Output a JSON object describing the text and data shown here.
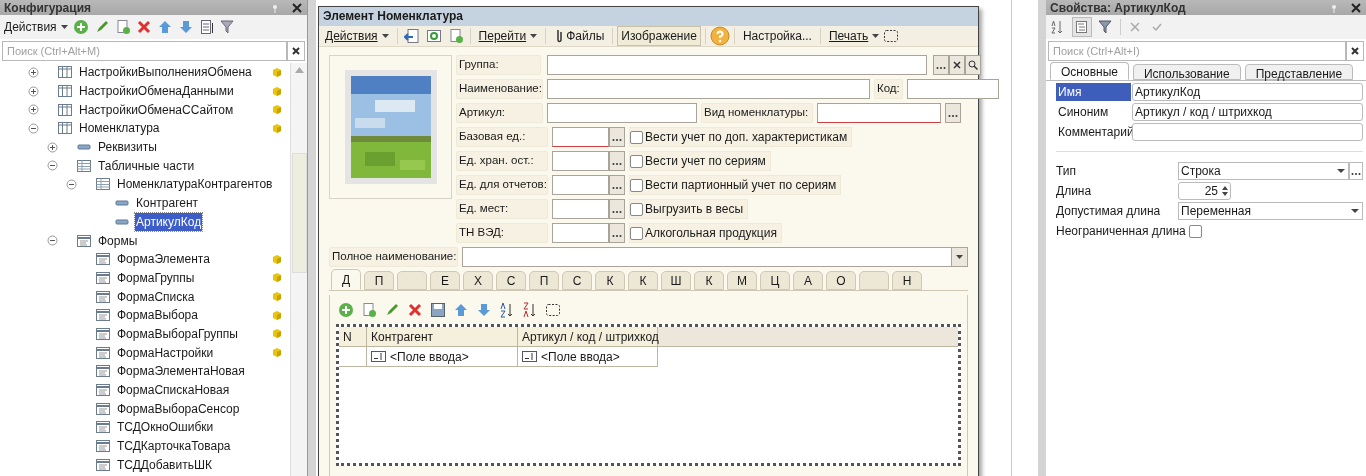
{
  "config_panel": {
    "title": "Конфигурация",
    "actions_menu": "Действия",
    "search": {
      "placeholder": "Поиск (Ctrl+Alt+M)"
    },
    "tree": [
      {
        "label": "НастройкиВыполненияОбмена",
        "kind": "register",
        "expanded": false,
        "locked": true
      },
      {
        "label": "НастройкиОбменаДанными",
        "kind": "register",
        "expanded": false,
        "locked": true
      },
      {
        "label": "НастройкиОбменаССайтом",
        "kind": "register",
        "expanded": false,
        "locked": true
      },
      {
        "label": "Номенклатура",
        "kind": "register",
        "expanded": true,
        "locked": true,
        "children": [
          {
            "label": "Реквизиты",
            "kind": "attribute",
            "expanded": false,
            "locked": false
          },
          {
            "label": "Табличные части",
            "kind": "tabular",
            "expanded": true,
            "locked": false,
            "children": [
              {
                "label": "НоменклатураКонтрагентов",
                "kind": "tabular",
                "expanded": true,
                "locked": false,
                "children": [
                  {
                    "label": "Контрагент",
                    "kind": "attribute",
                    "locked": false,
                    "selected": false
                  },
                  {
                    "label": "АртикулКод",
                    "kind": "attribute",
                    "locked": false,
                    "selected": true
                  }
                ]
              }
            ]
          },
          {
            "label": "Формы",
            "kind": "form",
            "expanded": true,
            "locked": false,
            "children": [
              {
                "label": "ФормаЭлемента",
                "kind": "form",
                "locked": true,
                "selected": false
              },
              {
                "label": "ФормаГруппы",
                "kind": "form",
                "locked": true,
                "selected": false
              },
              {
                "label": "ФормаСписка",
                "kind": "form",
                "locked": true,
                "selected": false
              },
              {
                "label": "ФормаВыбора",
                "kind": "form",
                "locked": true,
                "selected": false
              },
              {
                "label": "ФормаВыбораГруппы",
                "kind": "form",
                "locked": true,
                "selected": false
              },
              {
                "label": "ФормаНастройки",
                "kind": "form",
                "locked": true,
                "selected": false
              },
              {
                "label": "ФормаЭлементаНовая",
                "kind": "form",
                "locked": false,
                "selected": false
              },
              {
                "label": "ФормаСпискаНовая",
                "kind": "form",
                "locked": false,
                "selected": false
              },
              {
                "label": "ФормаВыбораСенсор",
                "kind": "form",
                "locked": false,
                "selected": false
              },
              {
                "label": "ТСДОкноОшибки",
                "kind": "form",
                "locked": false,
                "selected": false
              },
              {
                "label": "ТСДКарточкаТовара",
                "kind": "form",
                "locked": false,
                "selected": false
              },
              {
                "label": "ТСДДобавитьШК",
                "kind": "form",
                "locked": false,
                "selected": false
              }
            ]
          }
        ]
      }
    ]
  },
  "form": {
    "title": "Элемент Номенклатура",
    "toolbar": [
      {
        "kind": "menu",
        "label": "Действия",
        "pressed": false
      },
      {
        "kind": "menu",
        "label": "Перейти",
        "pressed": false
      },
      {
        "kind": "button",
        "label": "Файлы",
        "pressed": false
      },
      {
        "kind": "button",
        "label": "Изображение",
        "pressed": true
      },
      {
        "kind": "button",
        "label": "Настройка...",
        "pressed": false
      },
      {
        "kind": "menu",
        "label": "Печать",
        "pressed": false
      }
    ],
    "group": {
      "label": "Группа:"
    },
    "name": {
      "label": "Наименование:"
    },
    "code": {
      "label": "Код:"
    },
    "article": {
      "label": "Артикул:"
    },
    "item_kind": {
      "label": "Вид номенклатуры:",
      "required": true
    },
    "unit_rows": [
      {
        "label": "Базовая ед.:",
        "required": true,
        "checkbox": {
          "label": "Вести учет по доп.  характеристикам",
          "checked": false
        }
      },
      {
        "label": "Ед. хран. ост.:",
        "required": false,
        "checkbox": {
          "label": "Вести учет по сериям",
          "checked": false
        }
      },
      {
        "label": "Ед. для отчетов:",
        "required": false,
        "checkbox": {
          "label": "Вести партионный учет по сериям",
          "checked": false
        }
      },
      {
        "label": "Ед. мест:",
        "required": false,
        "checkbox": {
          "label": "Выгрузить в весы",
          "checked": false
        }
      },
      {
        "label": "ТН ВЭД:",
        "required": false,
        "checkbox": {
          "label": "Алкогольная продукция",
          "checked": false
        }
      }
    ],
    "full_name": {
      "label": "Полное наименование:"
    },
    "tabs": [
      {
        "label": "Д",
        "selected": true
      },
      {
        "label": "П",
        "selected": false
      },
      {
        "selected": false
      },
      {
        "label": "Е",
        "selected": false
      },
      {
        "label": "Х",
        "selected": false
      },
      {
        "label": "С",
        "selected": false
      },
      {
        "label": "П",
        "selected": false
      },
      {
        "label": "С",
        "selected": false
      },
      {
        "label": "К",
        "selected": false
      },
      {
        "label": "К",
        "selected": false
      },
      {
        "label": "Ш",
        "selected": false
      },
      {
        "label": "К",
        "selected": false
      },
      {
        "label": "М",
        "selected": false
      },
      {
        "label": "Ц",
        "selected": false
      },
      {
        "label": "А",
        "selected": false
      },
      {
        "label": "О",
        "selected": false
      },
      {
        "selected": false
      },
      {
        "label": "Н",
        "selected": false
      }
    ],
    "table": {
      "columns": [
        "N",
        "Контрагент",
        "Артикул / код / штрихкод"
      ],
      "rows": [
        [
          "",
          "<Поле ввода>",
          "<Поле ввода>"
        ]
      ]
    }
  },
  "properties_panel": {
    "title": "Свойства: АртикулКод",
    "search": {
      "placeholder": "Поиск (Ctrl+Alt+I)"
    },
    "tabs": [
      {
        "label": "Основные",
        "selected": true
      },
      {
        "label": "Использование",
        "selected": false
      },
      {
        "label": "Представление",
        "selected": false
      }
    ],
    "text_props": [
      {
        "label": "Имя",
        "value": "АртикулКод",
        "selected": true
      },
      {
        "label": "Синоним",
        "value": "Артикул / код / штрихкод",
        "selected": false
      },
      {
        "label": "Комментарий",
        "selected": false
      }
    ],
    "type": {
      "label": "Тип",
      "value": "Строка"
    },
    "length": {
      "label": "Длина",
      "value": "25"
    },
    "allowed_length": {
      "label": "Допустимая длина",
      "value": "Переменная"
    },
    "unlimited": {
      "label": "Неограниченная длина",
      "checked": false
    }
  }
}
